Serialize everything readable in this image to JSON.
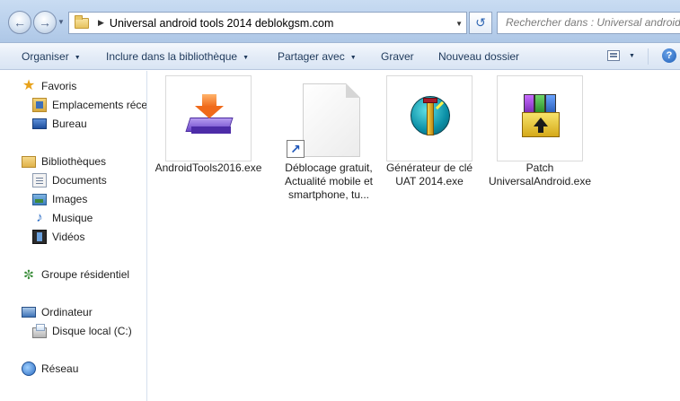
{
  "address_bar": {
    "path": "Universal android tools 2014 deblokgsm.com",
    "search_placeholder": "Rechercher dans : Universal android t"
  },
  "toolbar": {
    "organiser": "Organiser",
    "inclure": "Inclure dans la bibliothèque",
    "partager": "Partager avec",
    "graver": "Graver",
    "nouveau_dossier": "Nouveau dossier"
  },
  "sidebar": {
    "favoris": "Favoris",
    "emplacements": "Emplacements récents",
    "bureau": "Bureau",
    "bibliotheques": "Bibliothèques",
    "documents": "Documents",
    "images": "Images",
    "musique": "Musique",
    "videos": "Vidéos",
    "groupe": "Groupe résidentiel",
    "ordinateur": "Ordinateur",
    "disque": "Disque local (C:)",
    "reseau": "Réseau"
  },
  "files": [
    {
      "name": "AndroidTools2016.exe",
      "icon": "android-tools-installer-icon"
    },
    {
      "name": "Déblocage gratuit, Actualité mobile et smartphone, tu...",
      "icon": "document-shortcut-icon"
    },
    {
      "name": "Générateur de clé UAT 2014.exe",
      "icon": "key-generator-icon"
    },
    {
      "name": "Patch UniversalAndroid.exe",
      "icon": "archive-patch-icon"
    }
  ]
}
